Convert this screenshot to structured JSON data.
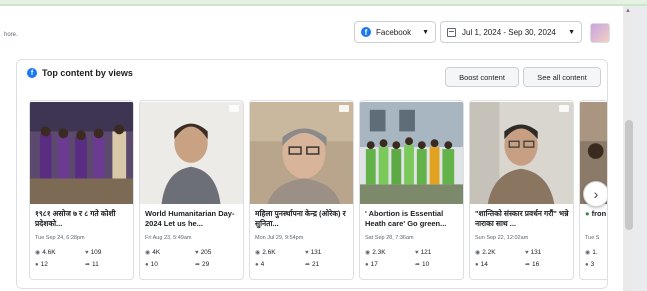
{
  "header": {
    "cut_text": "hore.",
    "platform_label": "Facebook",
    "date_range": "Jul 1, 2024 - Sep 30, 2024"
  },
  "card": {
    "title": "Top content by views",
    "boost_label": "Boost content",
    "see_all_label": "See all content"
  },
  "posts": [
    {
      "title": "१९८१ असोज ७ र ८ गते कोशी प्रदेशको...",
      "date": "Tue Sep 24, 6:28pm",
      "views": "4.6K",
      "reactions": "109",
      "comments": "12",
      "shares": "11"
    },
    {
      "title": "World Humanitarian Day-2024 Let us he...",
      "date": "Fri Aug 23, 5:49am",
      "views": "4K",
      "reactions": "205",
      "comments": "10",
      "shares": "29"
    },
    {
      "title": "महिला पुनर्स्थापना केन्द्र (ओरेक) र सुनिता...",
      "date": "Mon Jul 29, 9:54pm",
      "views": "2.6K",
      "reactions": "131",
      "comments": "4",
      "shares": "21"
    },
    {
      "title": "' Abortion is Essential Heath care' Go green...",
      "date": "Sat Sep 28, 7:36am",
      "views": "2.3K",
      "reactions": "121",
      "comments": "17",
      "shares": "10"
    },
    {
      "title": "\"शान्तिको संस्कार प्रवर्धन गरौं\" भन्ने नाराका साथ ...",
      "date": "Sun Sep 22, 12:02am",
      "views": "2.2K",
      "reactions": "131",
      "comments": "14",
      "shares": "16"
    },
    {
      "title": "fron",
      "date": "Tue S",
      "views": "1.",
      "reactions": "",
      "comments": "3",
      "shares": ""
    }
  ]
}
